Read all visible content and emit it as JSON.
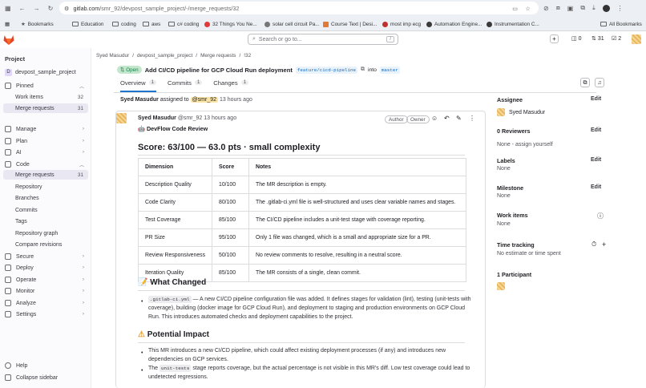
{
  "browser": {
    "url_host": "gitlab.com",
    "url_path": "/smr_92/devpost_sample_project/-/merge_requests/32",
    "bookmarks": [
      "Bookmarks",
      "Education",
      "coding",
      "aws",
      "c# coding",
      "32 Things You Ne...",
      "solar cell circuit Pa...",
      "Course Text | Desi...",
      "most imp ecg",
      "Automation Engine...",
      "Instrumentation C...",
      "All Bookmarks"
    ]
  },
  "topbar": {
    "search_placeholder": "Search or go to...",
    "shortcut": "/",
    "issues_count": "0",
    "mr_count": "31",
    "todo_count": "2"
  },
  "sidebar": {
    "project_label": "Project",
    "project_name": "devpost_sample_project",
    "initial": "D",
    "pinned": "Pinned",
    "work_items": "Work items",
    "work_items_count": "32",
    "merge_requests": "Merge requests",
    "merge_requests_count": "31",
    "manage": "Manage",
    "plan": "Plan",
    "ai": "AI",
    "code": "Code",
    "code_sub": [
      "Merge requests",
      "Repository",
      "Branches",
      "Commits",
      "Tags",
      "Repository graph",
      "Compare revisions"
    ],
    "code_mr_count": "31",
    "secure": "Secure",
    "deploy": "Deploy",
    "operate": "Operate",
    "monitor": "Monitor",
    "analyze": "Analyze",
    "settings": "Settings",
    "help": "Help",
    "collapse": "Collapse sidebar"
  },
  "breadcrumb": [
    "Syed Masudur",
    "/",
    "devpost_sample_project",
    "/",
    "Merge requests",
    "/",
    "!32"
  ],
  "mr": {
    "status": "Open",
    "title": "Add CI/CD pipeline for GCP Cloud Run deployment",
    "source_branch": "feature/cicd-pipeline",
    "into": "into",
    "target_branch": "master"
  },
  "tabs": [
    {
      "label": "Overview",
      "count": "1"
    },
    {
      "label": "Commits",
      "count": "1"
    },
    {
      "label": "Changes",
      "count": "1"
    }
  ],
  "activity": {
    "actor": "Syed Masudur",
    "action": "assigned to",
    "handle": "@smr_92",
    "time": "13 hours ago"
  },
  "comment": {
    "author": "Syed Masudur",
    "handle": "@smr_92",
    "time": "13 hours ago",
    "badge_author": "Author",
    "badge_owner": "Owner",
    "review_title": "DevFlow Code Review",
    "score_heading": "Score: 63/100 — 63.0 pts · small complexity",
    "table_headers": [
      "Dimension",
      "Score",
      "Notes"
    ],
    "rows": [
      [
        "Description Quality",
        "10/100",
        "The MR description is empty."
      ],
      [
        "Code Clarity",
        "80/100",
        "The .gitlab-ci.yml file is well-structured and uses clear variable names and stages."
      ],
      [
        "Test Coverage",
        "85/100",
        "The CI/CD pipeline includes a unit-test stage with coverage reporting."
      ],
      [
        "PR Size",
        "95/100",
        "Only 1 file was changed, which is a small and appropriate size for a PR."
      ],
      [
        "Review Responsiveness",
        "50/100",
        "No review comments to resolve, resulting in a neutral score."
      ],
      [
        "Iteration Quality",
        "85/100",
        "The MR consists of a single, clean commit."
      ]
    ],
    "what_changed_heading": "What Changed",
    "wc_code": ".gitlab-ci.yml",
    "wc_text": "— A new CI/CD pipeline configuration file was added. It defines stages for validation (lint), testing (unit-tests with coverage), building (docker image for GCP Cloud Run), and deployment to staging and production environments on GCP Cloud Run. This introduces automated checks and deployment capabilities to the project.",
    "impact_heading": "Potential Impact",
    "impact_1": "This MR introduces a new CI/CD pipeline, which could affect existing deployment processes (if any) and introduces new dependencies on GCP services.",
    "impact_2_pre": "The",
    "impact_2_code": "unit-tests",
    "impact_2_post": "stage reports coverage, but the actual percentage is not visible in this MR's diff. Low test coverage could lead to undetected regressions."
  },
  "right": {
    "assignee": "Assignee",
    "assignee_name": "Syed Masudur",
    "edit": "Edit",
    "reviewers": "0 Reviewers",
    "reviewers_val": "None - assign yourself",
    "labels": "Labels",
    "labels_val": "None",
    "milestone": "Milestone",
    "milestone_val": "None",
    "work_items": "Work items",
    "work_items_val": "None",
    "time": "Time tracking",
    "time_val": "No estimate or time spent",
    "participants": "1 Participant"
  },
  "colors": {
    "accent": "#1f75cb",
    "open_green": "#108548",
    "tanuki": "#e24329"
  }
}
